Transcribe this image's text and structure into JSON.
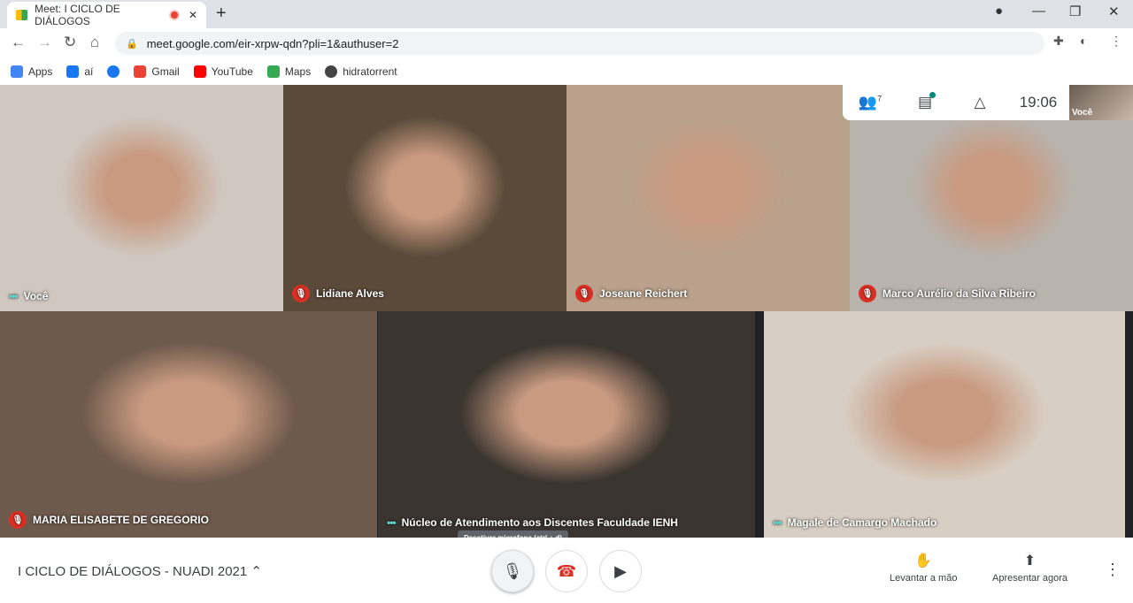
{
  "browser": {
    "tab_title": "Meet: I CICLO DE DIÁLOGOS",
    "url": "meet.google.com/eir-xrpw-qdn?pli=1&authuser=2",
    "bookmarks": [
      {
        "label": "Apps",
        "color": "#4285f4"
      },
      {
        "label": "aí",
        "color": "#1877f2"
      },
      {
        "label": "",
        "color": "#1877f2"
      },
      {
        "label": "Gmail",
        "color": "#ea4335"
      },
      {
        "label": "YouTube",
        "color": "#ff0000"
      },
      {
        "label": "Maps",
        "color": "#34a853"
      },
      {
        "label": "hidratorrent",
        "color": "#444"
      }
    ]
  },
  "meet": {
    "participants_count": "7",
    "time": "19:06",
    "self_label": "Você",
    "tiles": [
      {
        "name": "Você",
        "state": "speaking",
        "bg": "#cfc7c0"
      },
      {
        "name": "Lidiane Alves",
        "state": "muted",
        "bg": "#5a4a3a"
      },
      {
        "name": "Joseane Reichert",
        "state": "muted",
        "bg": "#b9a18c"
      },
      {
        "name": "Marco Aurélio da Silva Ribeiro",
        "state": "muted",
        "bg": "#b8b3ad"
      },
      {
        "name": "MARIA ELISABETE DE GREGORIO",
        "state": "muted",
        "bg": "#6e5a4c"
      },
      {
        "name": "Núcleo de Atendimento aos Discentes Faculdade IENH",
        "state": "speaking",
        "bg": "#3a3530"
      },
      {
        "name": "Magale de Camargo Machado",
        "state": "speaking",
        "bg": "#d8cfc4"
      }
    ],
    "meeting_name": "I CICLO DE DIÁLOGOS - NUADI 2021",
    "tooltip": "Desativar microfone (ctrl + d)",
    "raise_hand": "Levantar a mão",
    "present": "Apresentar agora"
  }
}
